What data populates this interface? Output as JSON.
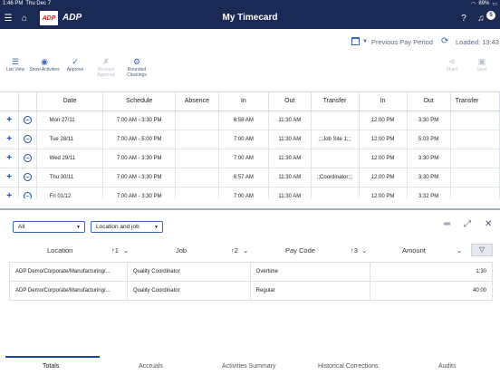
{
  "status_bar": {
    "time": "1:46 PM",
    "date": "Thu Dec 7",
    "battery": "89%"
  },
  "header": {
    "logo_short": "ADP",
    "logo_text": "ADP",
    "title": "My Timecard",
    "notification_count": "5"
  },
  "period": {
    "label": "Previous Pay Period",
    "loaded": "Loaded: 13:43"
  },
  "toolbar": {
    "list_view": "List View",
    "show_activities": "Show Activities",
    "approve": "Approve",
    "remove_approval": "Remove Approval",
    "rounded_clockings": "Rounded Clockings",
    "share": "Share",
    "save": "Save"
  },
  "grid": {
    "columns": [
      "Date",
      "Schedule",
      "Absence",
      "In",
      "Out",
      "Transfer",
      "In",
      "Out",
      "Transfer"
    ],
    "rows": [
      {
        "date": "Mon 27/11",
        "schedule": "7:00 AM - 3:30 PM",
        "absence": "",
        "in1": "6:58 AM",
        "out1": "11:30 AM",
        "transfer1": "",
        "in2": "12:00 PM",
        "out2": "3:30 PM",
        "transfer2": ""
      },
      {
        "date": "Tue 28/11",
        "schedule": "7:00 AM - 5:00 PM",
        "absence": "",
        "in1": "7:00 AM",
        "out1": "11:30 AM",
        "transfer1": ";;;Job Site 1;;;",
        "in2": "12:00 PM",
        "out2": "5:03 PM",
        "transfer2": ""
      },
      {
        "date": "Wed 29/11",
        "schedule": "7:00 AM - 3:30 PM",
        "absence": "",
        "in1": "7:00 AM",
        "out1": "11:30 AM",
        "transfer1": "",
        "in2": "12:00 PM",
        "out2": "3:30 PM",
        "transfer2": ""
      },
      {
        "date": "Thu 30/11",
        "schedule": "7:00 AM - 3:30 PM",
        "absence": "",
        "in1": "6:57 AM",
        "out1": "11:30 AM",
        "transfer1": ";;Coordinator;;;",
        "in2": "12:00 PM",
        "out2": "3:30 PM",
        "transfer2": ""
      },
      {
        "date": "Fri 01/12",
        "schedule": "7:00 AM - 3:30 PM",
        "absence": "",
        "in1": "7:00 AM",
        "out1": "11:30 AM",
        "transfer1": "",
        "in2": "12:00 PM",
        "out2": "3:32 PM",
        "transfer2": ""
      }
    ]
  },
  "panel": {
    "filter_all": "All",
    "filter_group": "Location and job",
    "columns": {
      "location": "Location",
      "sort1": "↑1",
      "job": "Job",
      "sort2": "↑2",
      "paycode": "Pay Code",
      "sort3": "↑3",
      "amount": "Amount"
    },
    "rows": [
      {
        "location": "ADP Demo/Corporate/Manufacturing/...",
        "job": "Quality Coordinator",
        "paycode": "Overtime",
        "amount": "1:30"
      },
      {
        "location": "ADP Demo/Corporate/Manufacturing/...",
        "job": "Quality Coordinator",
        "paycode": "Regular",
        "amount": "40:00"
      }
    ],
    "tabs": [
      "Totals",
      "Accruals",
      "Activities Summary",
      "Historical Corrections",
      "Audits"
    ]
  }
}
